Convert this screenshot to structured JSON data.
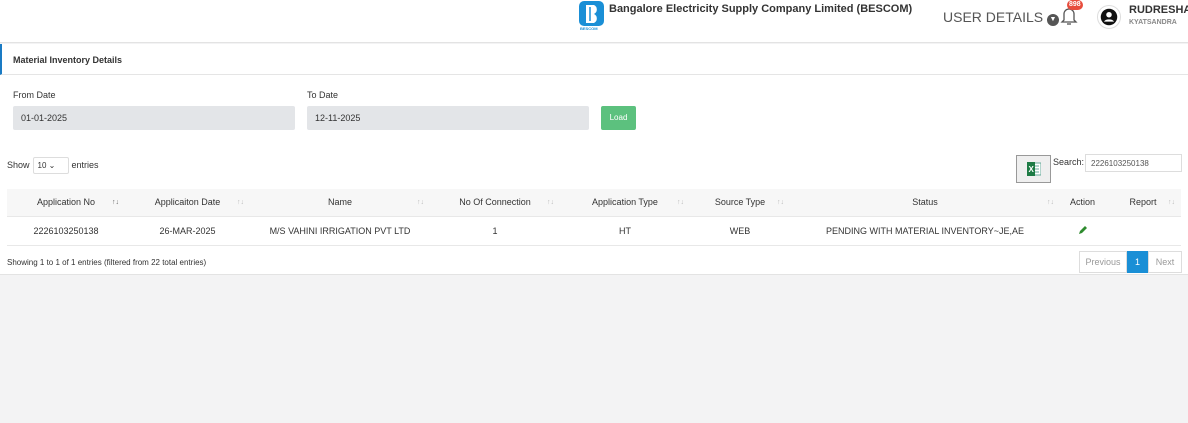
{
  "header": {
    "org_name": "Bangalore Electricity Supply Company Limited (BESCOM)",
    "logo_text": "BESCOM",
    "user_details": "USER DETAILS",
    "notification_count": "898",
    "user_name": "RUDRESHA",
    "user_location": "KYATSANDRA"
  },
  "panel": {
    "title": "Material Inventory Details",
    "from_label": "From Date",
    "from_value": "01-01-2025",
    "to_label": "To Date",
    "to_value": "12-11-2025",
    "load_label": "Load"
  },
  "table_controls": {
    "show": "Show",
    "page_size": "10",
    "entries": "entries",
    "search_label": "Search:",
    "search_value": "2226103250138"
  },
  "table": {
    "columns": [
      "Application No",
      "Applicaiton Date",
      "Name",
      "No Of Connection",
      "Application Type",
      "Source Type",
      "Status",
      "Action",
      "Report"
    ],
    "rows": [
      [
        "2226103250138",
        "26-MAR-2025",
        "M/S VAHINI IRRIGATION PVT LTD",
        "1",
        "HT",
        "WEB",
        "PENDING WITH MATERIAL INVENTORY~JE,AE"
      ]
    ]
  },
  "footer": {
    "info": "Showing 1 to 1 of 1 entries (filtered from 22 total entries)",
    "previous": "Previous",
    "page": "1",
    "next": "Next"
  },
  "colors": {
    "accent": "#1a7bc4",
    "load": "#5cc17e",
    "badge": "#e74c3c"
  }
}
